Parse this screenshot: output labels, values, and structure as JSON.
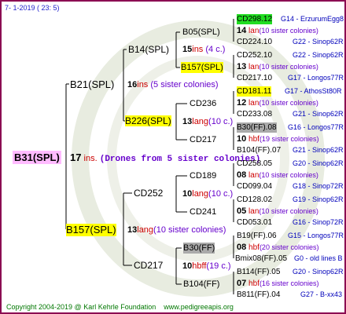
{
  "header": {
    "date": "7-  1-2019  ( 23:  5)"
  },
  "footer": {
    "copyright": "Copyright 2004-2019 @ Karl Kehrle Foundation",
    "url": "www.pedigreeapis.org"
  },
  "colors": {
    "frame": "#8b0c52",
    "yellow": "#ffff00",
    "green": "#22dd22",
    "gray": "#aaaaaa",
    "pink": "#ffbbff",
    "ins": "#cc0000",
    "colonies": "#6600cc",
    "leafText": "#0000bb",
    "footer": "#007700"
  },
  "root": {
    "label": "B31(SPL)",
    "ins_num": "17",
    "ins_word": "ins.",
    "ins_desc": "(Drones from 5 sister colonies)"
  },
  "lvl1": [
    {
      "label": "B21(SPL)",
      "ins_num": "16",
      "ins_word": "ins",
      "ins_desc": "(5 sister colonies)"
    },
    {
      "label": "B157(SPL)",
      "ins_num": "13",
      "ins_word": "lang",
      "ins_desc": "(10 sister colonies)"
    }
  ],
  "lvl2": [
    {
      "label": "B14(SPL)",
      "ins_num": "15",
      "ins_word": "ins",
      "ins_desc": "(4 c.)"
    },
    {
      "label": "B226(SPL)",
      "ins_num": "13",
      "ins_word": "lang",
      "ins_desc": "(10 c.)"
    },
    {
      "label": "CD252",
      "ins_num": "10",
      "ins_word": "lang",
      "ins_desc": "(10 c.)"
    },
    {
      "label": "CD217",
      "ins_num": "10",
      "ins_word": "hbff",
      "ins_desc": "(19 c.)"
    }
  ],
  "lvl3": [
    {
      "label": "B05(SPL)"
    },
    {
      "label": "B157(SPL)"
    },
    {
      "label": "CD236"
    },
    {
      "label": "CD217"
    },
    {
      "label": "CD189"
    },
    {
      "label": "CD241"
    },
    {
      "label": "B30(FF)"
    },
    {
      "label": "B104(FF)"
    }
  ],
  "leaves": [
    {
      "top": "CD298.12",
      "top_info": "G14 - ErzurumEgg8",
      "ins_num": "14",
      "ins_word": "lan",
      "ins_desc": "(10 sister colonies)",
      "bot": "CD224.10",
      "bot_info": "G22 - Sinop62R"
    },
    {
      "top": "CD252.10",
      "top_info": "G22 - Sinop62R",
      "ins_num": "13",
      "ins_word": "lan",
      "ins_desc": "(10 sister colonies)",
      "bot": "CD217.10",
      "bot_info": "G17 - Longos77R"
    },
    {
      "top": "CD181.11",
      "top_info": "G17 - AthosSt80R",
      "ins_num": "12",
      "ins_word": "lan",
      "ins_desc": "(10 sister colonies)",
      "bot": "CD233.08",
      "bot_info": "G21 - Sinop62R"
    },
    {
      "top": "B30(FF).08",
      "top_info": "G16 - Longos77R",
      "ins_num": "10",
      "ins_word": "hbf",
      "ins_desc": "(19 sister colonies)",
      "bot": "B104(FF).07",
      "bot_info": "G21 - Sinop62R"
    },
    {
      "top": "CD258.05",
      "top_info": "G20 - Sinop62R",
      "ins_num": "08",
      "ins_word": "lan",
      "ins_desc": "(10 sister colonies)",
      "bot": "CD099.04",
      "bot_info": "G18 - Sinop72R"
    },
    {
      "top": "CD128.02",
      "top_info": "G19 - Sinop62R",
      "ins_num": "05",
      "ins_word": "lan",
      "ins_desc": "(10 sister colonies)",
      "bot": "CD053.01",
      "bot_info": "G16 - Sinop72R"
    },
    {
      "top": "B19(FF).06",
      "top_info": "G15 - Longos77R",
      "ins_num": "08",
      "ins_word": "hbf",
      "ins_desc": "(20 sister colonies)",
      "bot": "Bmix08(FF).05",
      "bot_info": "G0 - old lines B"
    },
    {
      "top": "B114(FF).05",
      "top_info": "G20 - Sinop62R",
      "ins_num": "07",
      "ins_word": "hbf",
      "ins_desc": "(16 sister colonies)",
      "bot": "B811(FF).04",
      "bot_info": "G27 - B-xx43"
    }
  ]
}
